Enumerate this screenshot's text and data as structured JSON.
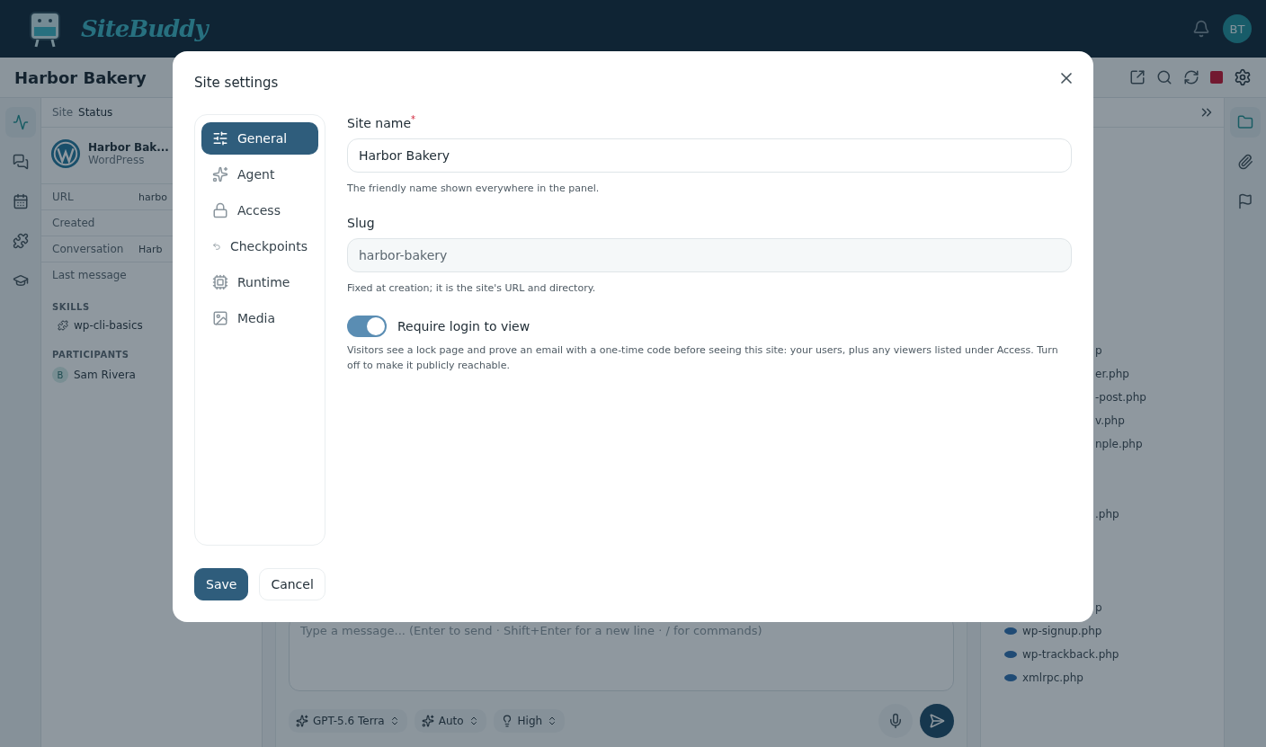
{
  "header": {
    "logo": "SiteBuddy",
    "avatar": "BT"
  },
  "page_title": "Harbor Bakery",
  "left_rail": [
    {
      "selected": true
    },
    {
      "selected": false
    },
    {
      "selected": false
    },
    {
      "selected": false
    },
    {
      "selected": false
    }
  ],
  "breadcrumb": [
    "Site",
    "Status"
  ],
  "site": {
    "name": "Harbor Bak...",
    "type": "WordPress"
  },
  "details": [
    {
      "label": "URL",
      "value": "harbo"
    },
    {
      "label": "Created"
    },
    {
      "label": "Conversation",
      "value": "Harb"
    },
    {
      "label": "Last message"
    }
  ],
  "skills": {
    "heading": "SKILLS",
    "items": [
      "wp-cli-basics"
    ]
  },
  "participants": {
    "heading": "PARTICIPANTS",
    "items": [
      {
        "initial": "B",
        "name": "Sam Rivera"
      }
    ]
  },
  "composer": {
    "placeholder": "Type a message...  (Enter to send · Shift+Enter for a new line · / for commands)",
    "pills": [
      "GPT-5.6 Terra",
      "Auto",
      "High"
    ]
  },
  "files": [
    {
      "name": "p",
      "kind": "partial"
    },
    {
      "name": "er.php",
      "kind": "partial"
    },
    {
      "name": "-post.php",
      "kind": "partial"
    },
    {
      "name": "v.php",
      "kind": "partial"
    },
    {
      "name": "nple.php",
      "kind": "partial"
    },
    {
      "name": ".php",
      "kind": "partial"
    },
    {
      "name": "p",
      "kind": "partial"
    },
    {
      "name": "wp-signup.php",
      "kind": "whole"
    },
    {
      "name": "wp-trackback.php",
      "kind": "whole"
    },
    {
      "name": "xmlrpc.php",
      "kind": "whole"
    }
  ],
  "right_rail": [
    {
      "selected": true
    },
    {
      "selected": false
    },
    {
      "selected": false
    }
  ],
  "modal": {
    "title": "Site settings",
    "nav": [
      {
        "label": "General",
        "selected": true
      },
      {
        "label": "Agent",
        "selected": false
      },
      {
        "label": "Access",
        "selected": false
      },
      {
        "label": "Checkpoints",
        "selected": false
      },
      {
        "label": "Runtime",
        "selected": false
      },
      {
        "label": "Media",
        "selected": false
      }
    ],
    "fields": [
      {
        "label": "Site name",
        "required_mark": "*",
        "value": "Harbor Bakery",
        "disabled": false,
        "help": "The friendly name shown everywhere in the panel."
      },
      {
        "label": "Slug",
        "value": "harbor-bakery",
        "disabled": true,
        "help": "Fixed at creation; it is the site's URL and directory."
      }
    ],
    "toggle": {
      "label": "Require login to view",
      "on": true,
      "help": "Visitors see a lock page and prove an email with a one-time code before seeing this site: your users, plus any viewers listed under Access. Turn off to make it publicly reachable."
    },
    "buttons": [
      {
        "label": "Save",
        "kind": "primary"
      },
      {
        "label": "Cancel",
        "kind": "secondary"
      }
    ]
  }
}
